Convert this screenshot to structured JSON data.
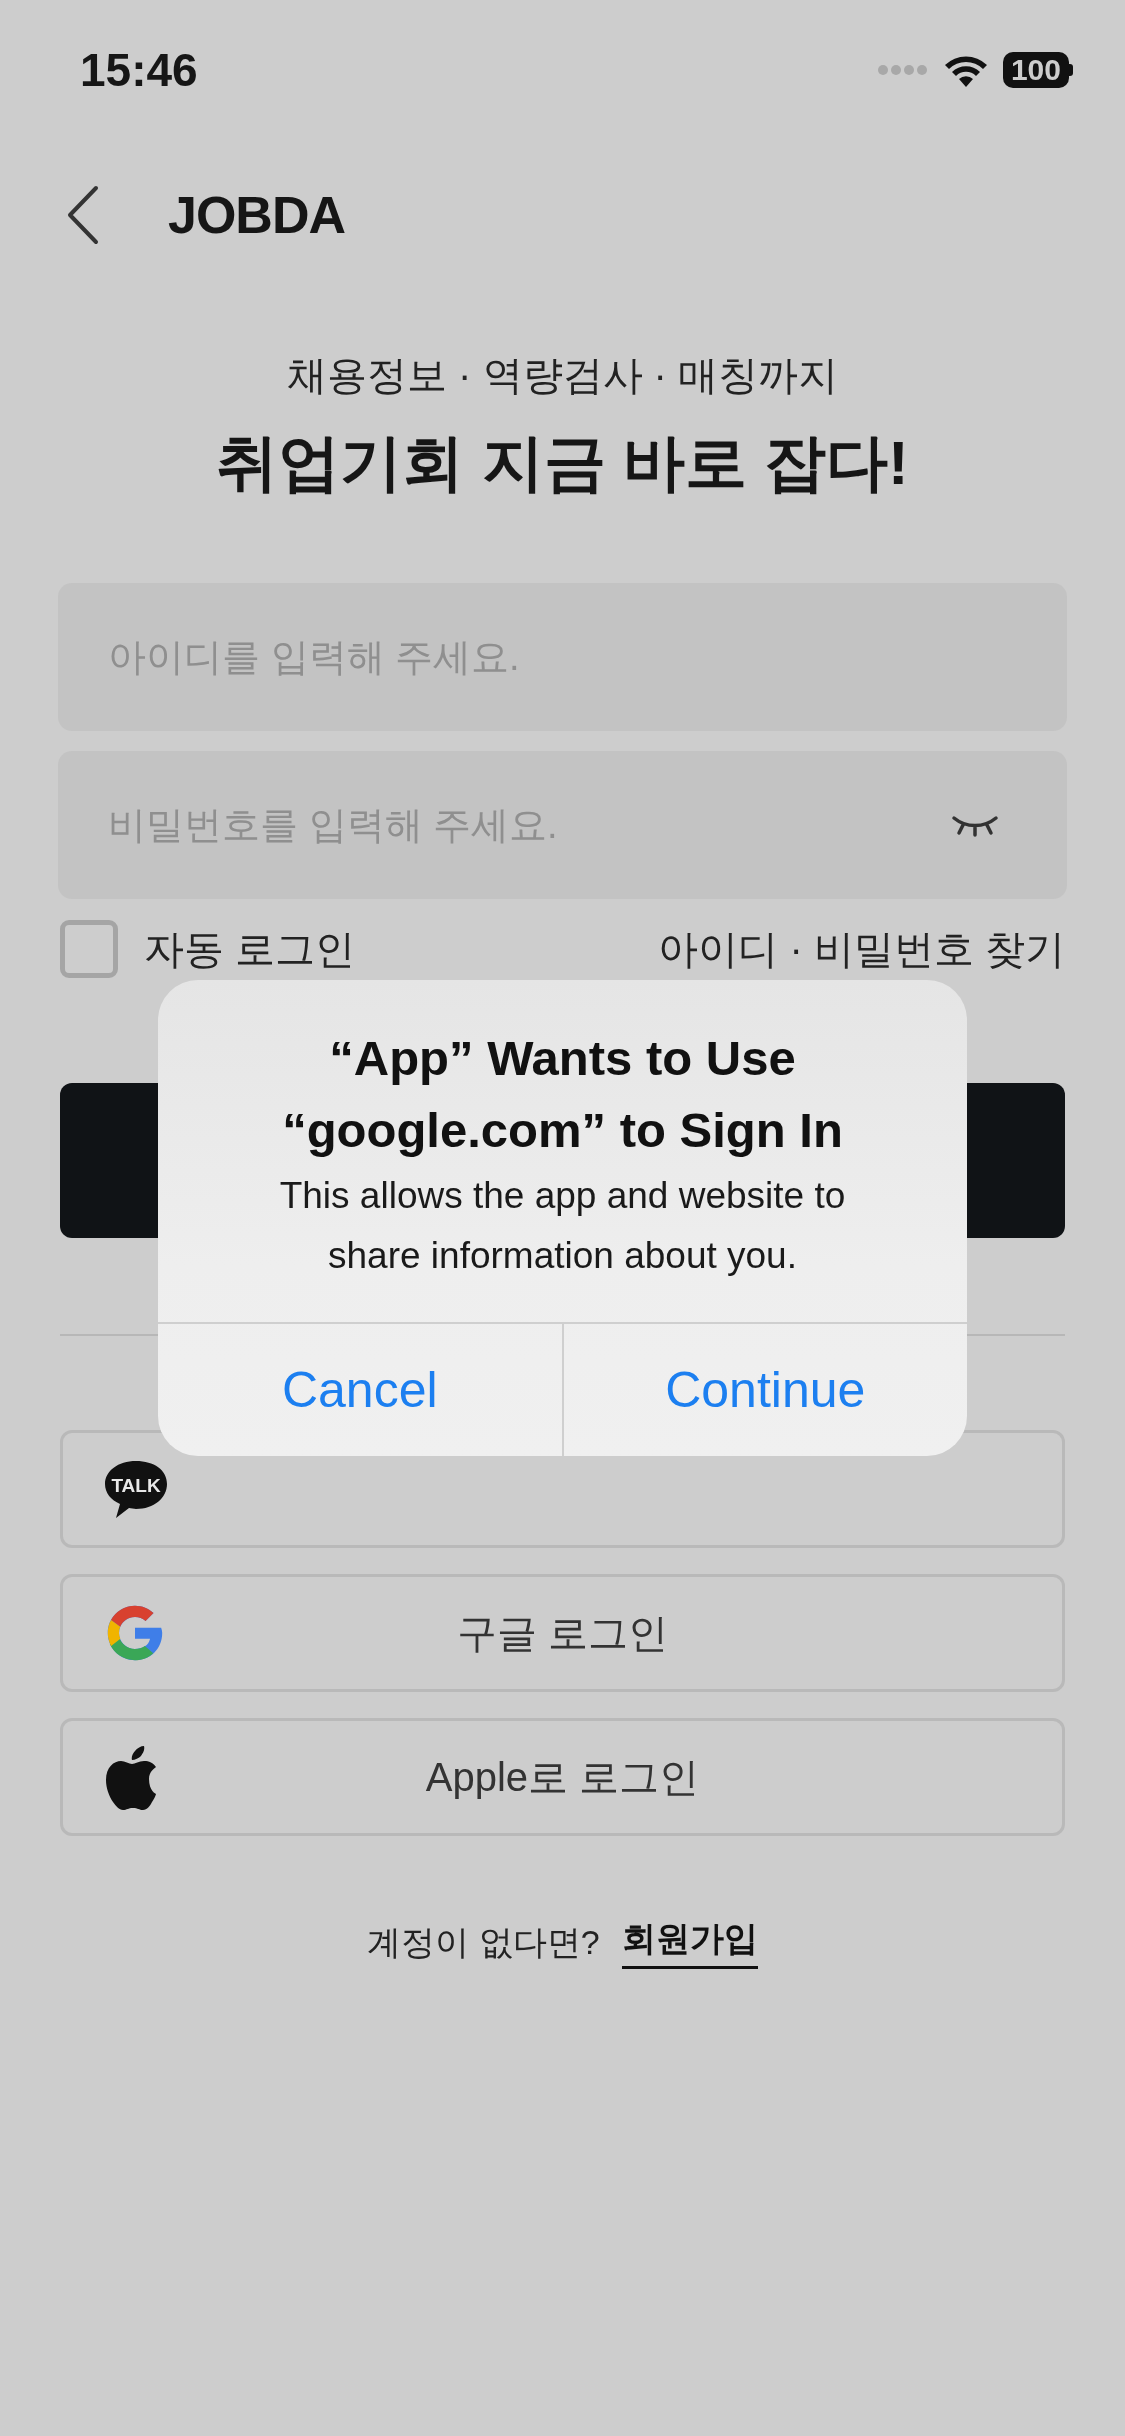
{
  "status_bar": {
    "time": "15:46",
    "battery": "100"
  },
  "header": {
    "logo": "JOBDA"
  },
  "tagline": "채용정보 · 역량검사 · 매칭까지",
  "headline": "취업기회 지금 바로 잡다!",
  "fields": [
    {
      "kind": "text",
      "placeholder": "아이디를 입력해 주세요."
    },
    {
      "kind": "password",
      "placeholder": "비밀번호를 입력해 주세요."
    }
  ],
  "auto_login": {
    "label": "자동 로그인",
    "checked": false
  },
  "find_link": "아이디 · 비밀번호 찾기",
  "social_buttons": [
    {
      "kind": "kakao",
      "icon_text": "TALK"
    },
    {
      "kind": "google",
      "label": "구글 로그인"
    },
    {
      "kind": "apple",
      "label": "Apple로 로그인"
    }
  ],
  "signup": {
    "prompt": "계정이 없다면?",
    "link": "회원가입"
  },
  "dialog": {
    "title": "“App” Wants to Use “google.com” to Sign In",
    "message": "This allows the app and website to share information about you.",
    "buttons": [
      "Cancel",
      "Continue"
    ]
  }
}
